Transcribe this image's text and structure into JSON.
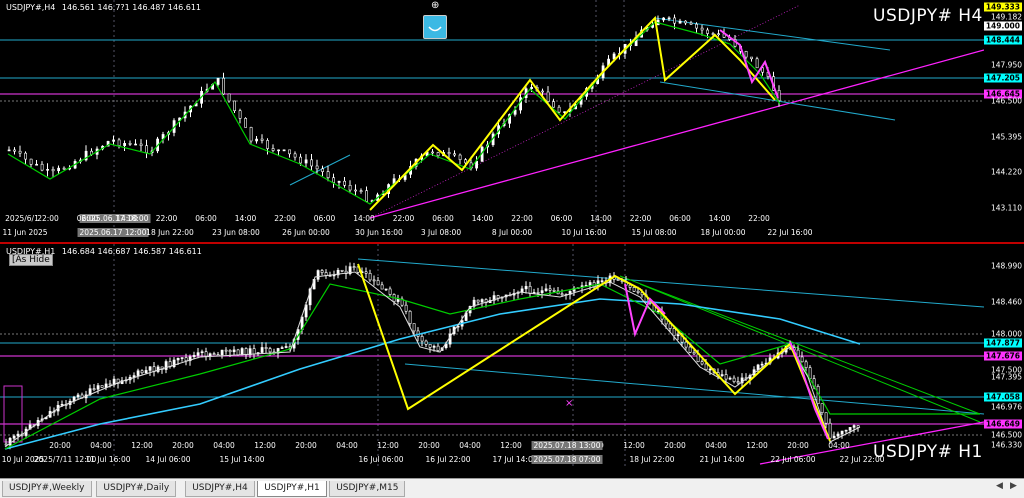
{
  "h4": {
    "info": {
      "symbol": "USDJPY#,H4",
      "ohlc": "146.561 146.7?1 146.487 146.611"
    },
    "big_label": "USDJPY# H4",
    "prices": [
      {
        "label": "149.333",
        "box": "#ffff00"
      },
      {
        "label": "149.182",
        "box": ""
      },
      {
        "label": "149.000",
        "box": "#ffffff"
      },
      {
        "label": "148.444",
        "box": "#00ffff"
      },
      {
        "label": "147.950",
        "box": ""
      },
      {
        "label": "147.205",
        "box": "#00ffff"
      },
      {
        "label": "146.645",
        "box": "#ff33ff"
      },
      {
        "label": "146.500",
        "box": ""
      },
      {
        "label": "145.395",
        "box": ""
      },
      {
        "label": "144.220",
        "box": ""
      },
      {
        "label": "143.110",
        "box": ""
      }
    ],
    "times": [
      "2025/6/1",
      "11 Jun 2025",
      "2025.06.17 18:00",
      "2025.06.17 12:00",
      "18 Jun 22:00",
      "23 Jun 08:00",
      "26 Jun 00:00",
      "30 Jun 16:00",
      "3 Jul 08:00",
      "8 Jul 00:00",
      "10 Jul 16:00",
      "15 Jul 08:00",
      "18 Jul 00:00",
      "22 Jul 16:00"
    ],
    "times_upper": [
      "22:00",
      "06:00",
      "14:00",
      "22:00",
      "06:00",
      "14:00",
      "22:00",
      "06:00",
      "14:00",
      "22:00",
      "06:00",
      "14:00",
      "22:00",
      "06:00",
      "14:00",
      "22:00",
      "06:00",
      "14:00",
      "22:00"
    ]
  },
  "h1": {
    "info": {
      "symbol": "USDJPY#,H1",
      "ohlc": "146.684 146.687 146.587 146.611"
    },
    "hide_button": "[As Hide",
    "big_label": "USDJPY# H1",
    "prices": [
      {
        "label": "148.990",
        "box": ""
      },
      {
        "label": "148.460",
        "box": ""
      },
      {
        "label": "148.000",
        "box": ""
      },
      {
        "label": "147.877",
        "box": "#00ffff"
      },
      {
        "label": "147.676",
        "box": "#ff33ff"
      },
      {
        "label": "147.500",
        "box": ""
      },
      {
        "label": "147.395",
        "box": ""
      },
      {
        "label": "147.058",
        "box": "#00ffff"
      },
      {
        "label": "146.976",
        "box": ""
      },
      {
        "label": "146.649",
        "box": "#ff33ff"
      },
      {
        "label": "146.500",
        "box": ""
      },
      {
        "label": "146.330",
        "box": ""
      }
    ],
    "times": [
      "10 Jul 2025",
      "2025/7/11 12:00",
      "11 Jul 16:00",
      "14 Jul 06:00",
      "15 Jul 14:00",
      "16 Jul 06:00",
      "16 Jul 22:00",
      "17 Jul 14:00",
      "2025.07.18 07:00",
      "18 Jul 22:00",
      "21 Jul 14:00",
      "22 Jul 06:00",
      "22 Jul 22:00"
    ],
    "time_box_upper": "2025.07.18 13:00",
    "times_upper": [
      "20:00",
      "04:00",
      "12:00",
      "20:00",
      "04:00",
      "12:00",
      "20:00",
      "04:00",
      "12:00",
      "20:00",
      "04:00",
      "12:00",
      "20:00",
      "04:00",
      "12:00",
      "20:00",
      "04:00",
      "12:00",
      "20:00",
      "04:00"
    ]
  },
  "tabs": [
    "USDJPY#,Weekly",
    "USDJPY#,Daily",
    "USDJPY#,H4",
    "USDJPY#,H1",
    "USDJPY#,M15"
  ],
  "active_tab": "USDJPY#,H1",
  "colors": {
    "zigzag": "#ffff00",
    "zigzag_alt": "#ff33ff",
    "ma_fast": "#00cc00",
    "ma_slow": "#00ffff",
    "trend": "#ff00ff"
  }
}
